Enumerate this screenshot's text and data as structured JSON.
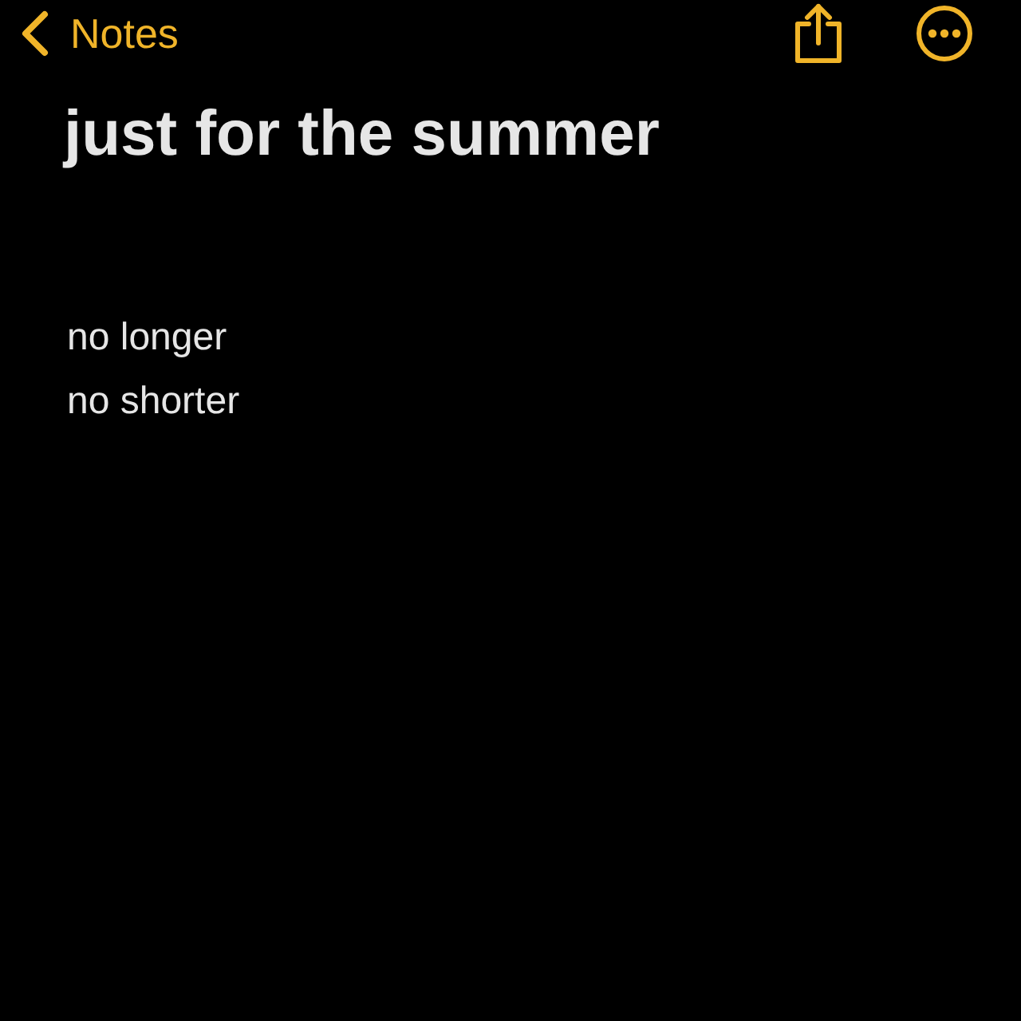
{
  "nav": {
    "back_label": "Notes"
  },
  "note": {
    "title": "just for the summer",
    "lines": [
      "no longer",
      "no shorter"
    ]
  }
}
